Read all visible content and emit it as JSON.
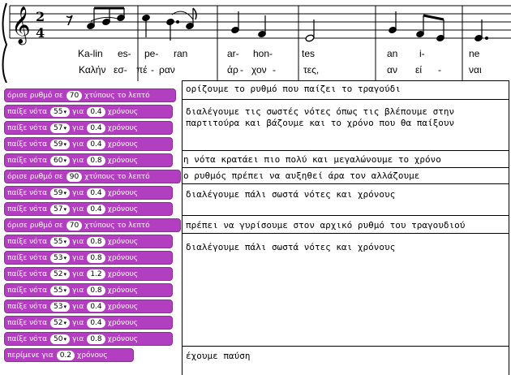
{
  "score": {
    "lyrics_latin": [
      "Ka-lin",
      "es-",
      "pe-",
      "ran",
      "ar-",
      "hon-",
      "tes",
      "an",
      "i-",
      "ne"
    ],
    "lyrics_greek": [
      "Καλήν",
      "εσ-",
      "πέ",
      "-",
      "ραν",
      "άρ",
      "-",
      "χον",
      "-",
      "τες,",
      "αν",
      "εί",
      "-",
      "ναι"
    ],
    "time_signature_top": "2",
    "time_signature_bottom": "4"
  },
  "blocks": [
    {
      "type": "tempo",
      "pre": "όρισε ρυθμό σε",
      "value": "70",
      "post": "χτύπους το λεπτό"
    },
    {
      "type": "note",
      "pre": "παίξε νότα",
      "value": "55",
      "mid": "για",
      "value2": "0.4",
      "post": "χρόνους"
    },
    {
      "type": "note",
      "pre": "παίξε νότα",
      "value": "57",
      "mid": "για",
      "value2": "0.4",
      "post": "χρόνους"
    },
    {
      "type": "note",
      "pre": "παίξε νότα",
      "value": "59",
      "mid": "για",
      "value2": "0.4",
      "post": "χρόνους"
    },
    {
      "type": "note",
      "pre": "παίξε νότα",
      "value": "60",
      "mid": "για",
      "value2": "0.8",
      "post": "χρόνους"
    },
    {
      "type": "tempo",
      "pre": "όρισε ρυθμό σε",
      "value": "90",
      "post": "χτύπους το λεπτό"
    },
    {
      "type": "note",
      "pre": "παίξε νότα",
      "value": "59",
      "mid": "για",
      "value2": "0.4",
      "post": "χρόνους"
    },
    {
      "type": "note",
      "pre": "παίξε νότα",
      "value": "57",
      "mid": "για",
      "value2": "0.4",
      "post": "χρόνους"
    },
    {
      "type": "tempo",
      "pre": "όρισε ρυθμό σε",
      "value": "70",
      "post": "χτύπους το λεπτό"
    },
    {
      "type": "note",
      "pre": "παίξε νότα",
      "value": "55",
      "mid": "για",
      "value2": "0.8",
      "post": "χρόνους"
    },
    {
      "type": "note",
      "pre": "παίξε νότα",
      "value": "53",
      "mid": "για",
      "value2": "0.8",
      "post": "χρόνους"
    },
    {
      "type": "note",
      "pre": "παίξε νότα",
      "value": "52",
      "mid": "για",
      "value2": "1.2",
      "post": "χρόνους"
    },
    {
      "type": "note",
      "pre": "παίξε νότα",
      "value": "55",
      "mid": "για",
      "value2": "0.8",
      "post": "χρόνους"
    },
    {
      "type": "note",
      "pre": "παίξε νότα",
      "value": "53",
      "mid": "για",
      "value2": "0.4",
      "post": "χρόνους"
    },
    {
      "type": "note",
      "pre": "παίξε νότα",
      "value": "52",
      "mid": "για",
      "value2": "0.4",
      "post": "χρόνους"
    },
    {
      "type": "note",
      "pre": "παίξε νότα",
      "value": "50",
      "mid": "για",
      "value2": "0.8",
      "post": "χρόνους"
    },
    {
      "type": "wait",
      "pre": "περίμενε για",
      "value": "0.2",
      "post": "χρόνους"
    }
  ],
  "notes": [
    "ορίζουμε το ρυθμό που παίζει το τραγούδι",
    "διαλέγουμε τις σωστές νότες όπως τις βλέπουμε στην παρτιτούρα και βάζουμε και το χρόνο που θα παίξουν",
    "η νότα κρατάει πιο πολύ και μεγαλώνουμε το χρόνο",
    "ο ρυθμός πρέπει να αυξηθεί άρα τον αλλάζουμε",
    "διαλέγουμε πάλι σωστά νότες και χρόνους",
    "πρέπει να γυρίσουμε στον αρχικό ρυθμό του τραγουδιού",
    "διαλέγουμε πάλι σωστά νότες και χρόνους",
    "έχουμε παύση"
  ],
  "colors": {
    "block_fill": "#b13fbf",
    "block_border": "#8d2d99",
    "text": "#000000"
  }
}
